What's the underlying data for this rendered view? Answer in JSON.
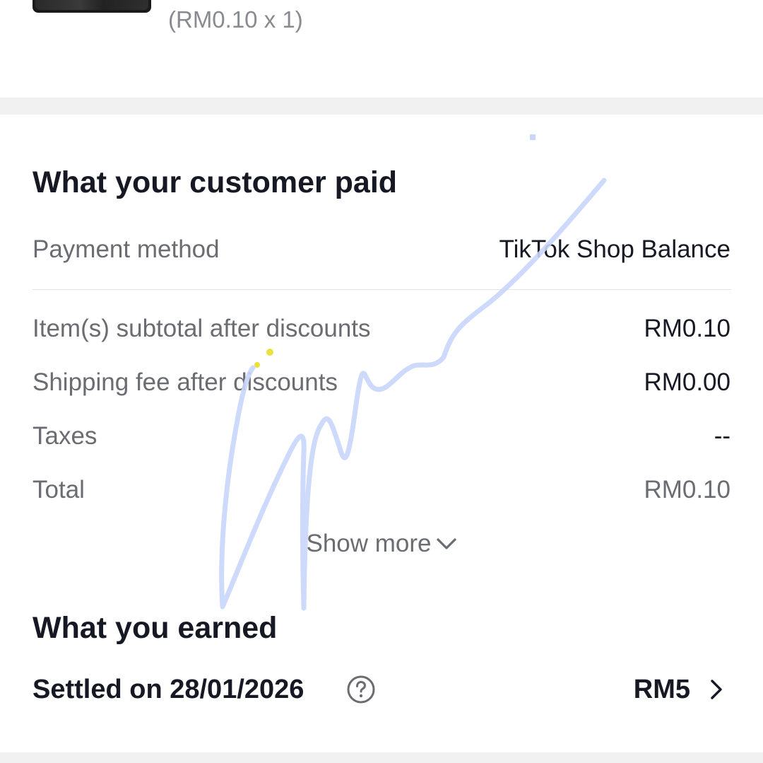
{
  "product": {
    "qty_text": "(RM0.10 x 1)"
  },
  "customer_paid": {
    "heading": "What your customer paid",
    "payment_method_label": "Payment method",
    "payment_method_value": "TikTok Shop Balance",
    "rows": [
      {
        "label": "Item(s) subtotal after discounts",
        "value": "RM0.10"
      },
      {
        "label": "Shipping fee after discounts",
        "value": "RM0.00"
      },
      {
        "label": "Taxes",
        "value": "--"
      },
      {
        "label": "Total",
        "value": "RM0.10"
      }
    ],
    "show_more_label": "Show more",
    "show_more_icon": "chevron-down-icon"
  },
  "earned": {
    "heading": "What you earned",
    "settled_label": "Settled on 28/01/2026",
    "help_icon": "question-circle-icon",
    "amount": "RM5",
    "chevron_icon": "chevron-right-icon"
  },
  "colors": {
    "primary_text": "#161823",
    "secondary_text": "#6b6c72",
    "section_gap": "#f1f1f2",
    "annotation_stroke": "#c9d6fb",
    "annotation_dots": "#e8e23a"
  }
}
